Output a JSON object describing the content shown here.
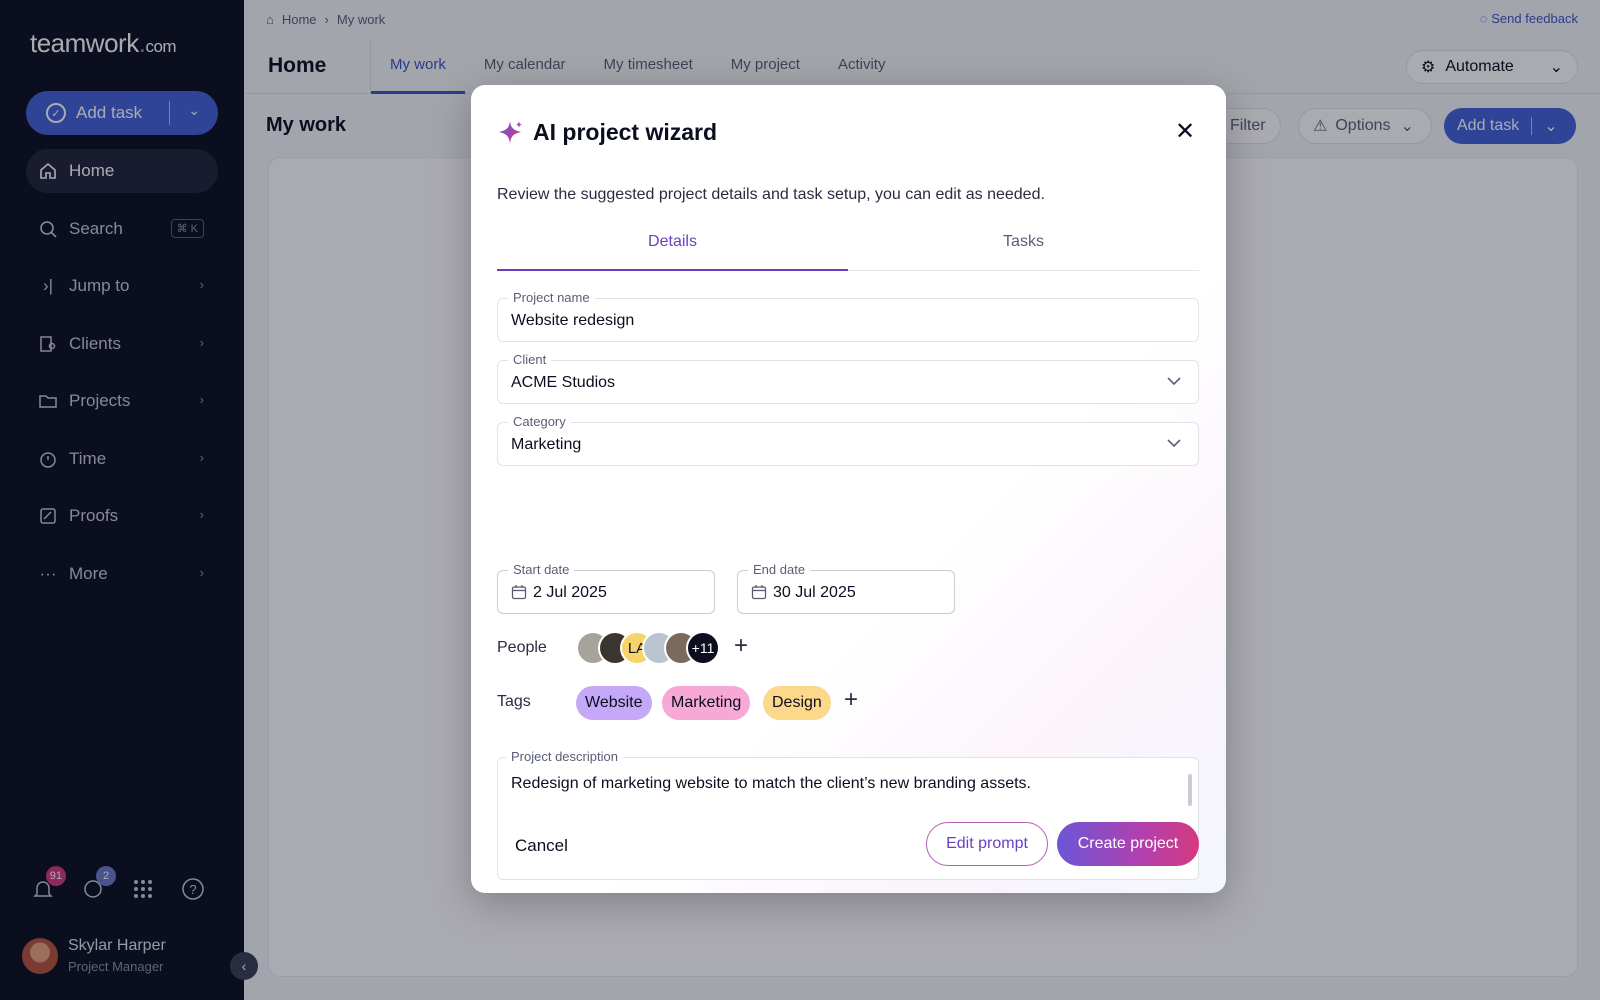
{
  "sidebar": {
    "logo_text": "teamwork",
    "logo_dot": ".",
    "logo_suffix": "com",
    "add_task_label": "Add task",
    "items": [
      {
        "label": "Home",
        "icon": "home-icon"
      },
      {
        "label": "Search",
        "icon": "search-icon",
        "shortcut": "⌘ K"
      },
      {
        "label": "Jump to",
        "icon": "jump-icon"
      },
      {
        "label": "Clients",
        "icon": "clients-icon"
      },
      {
        "label": "Projects",
        "icon": "folder-icon"
      },
      {
        "label": "Time",
        "icon": "timer-icon"
      },
      {
        "label": "Proofs",
        "icon": "proofs-icon"
      },
      {
        "label": "More",
        "icon": "more-icon"
      }
    ],
    "notifications_count": "91",
    "chat_count": "2",
    "user": {
      "name": "Skylar Harper",
      "role": "Project Manager"
    }
  },
  "header": {
    "breadcrumb": [
      "Home",
      "My work"
    ],
    "feedback_label": "Send feedback",
    "page_title": "Home",
    "tabs": [
      "My work",
      "My calendar",
      "My timesheet",
      "My project",
      "Activity"
    ],
    "active_tab": "My work",
    "automate_label": "Automate"
  },
  "toolbar": {
    "section_title": "My work",
    "filter_label": "Filter",
    "options_label": "Options",
    "add_task_label": "Add task"
  },
  "modal": {
    "title": "AI project wizard",
    "subtitle": "Review the suggested project details and task setup, you can edit as needed.",
    "tabs": [
      "Details",
      "Tasks"
    ],
    "active_tab": "Details",
    "fields": {
      "project_name": {
        "label": "Project name",
        "value": "Website redesign"
      },
      "client": {
        "label": "Client",
        "value": "ACME Studios"
      },
      "category": {
        "label": "Category",
        "value": "Marketing"
      },
      "start_date": {
        "label": "Start date",
        "value": "2 Jul 2025"
      },
      "end_date": {
        "label": "End date",
        "value": "30 Jul 2025"
      }
    },
    "people": {
      "label": "People",
      "avatars": [
        {
          "initials": "",
          "color": "#a8a39a"
        },
        {
          "initials": "",
          "color": "#3b3530"
        },
        {
          "initials": "LA",
          "color": "#f5d56b"
        },
        {
          "initials": "",
          "color": "#b9c4cf"
        },
        {
          "initials": "",
          "color": "#7a6a5d"
        }
      ],
      "overflow": "+11"
    },
    "tags": {
      "label": "Tags",
      "items": [
        {
          "label": "Website",
          "color": "#c5a8f7"
        },
        {
          "label": "Marketing",
          "color": "#f7a8d6"
        },
        {
          "label": "Design",
          "color": "#fcd98a"
        }
      ]
    },
    "description": {
      "label": "Project description",
      "value": "Redesign of marketing website to match the client’s new branding assets."
    },
    "cancel_label": "Cancel",
    "edit_prompt_label": "Edit prompt",
    "create_label": "Create project"
  }
}
